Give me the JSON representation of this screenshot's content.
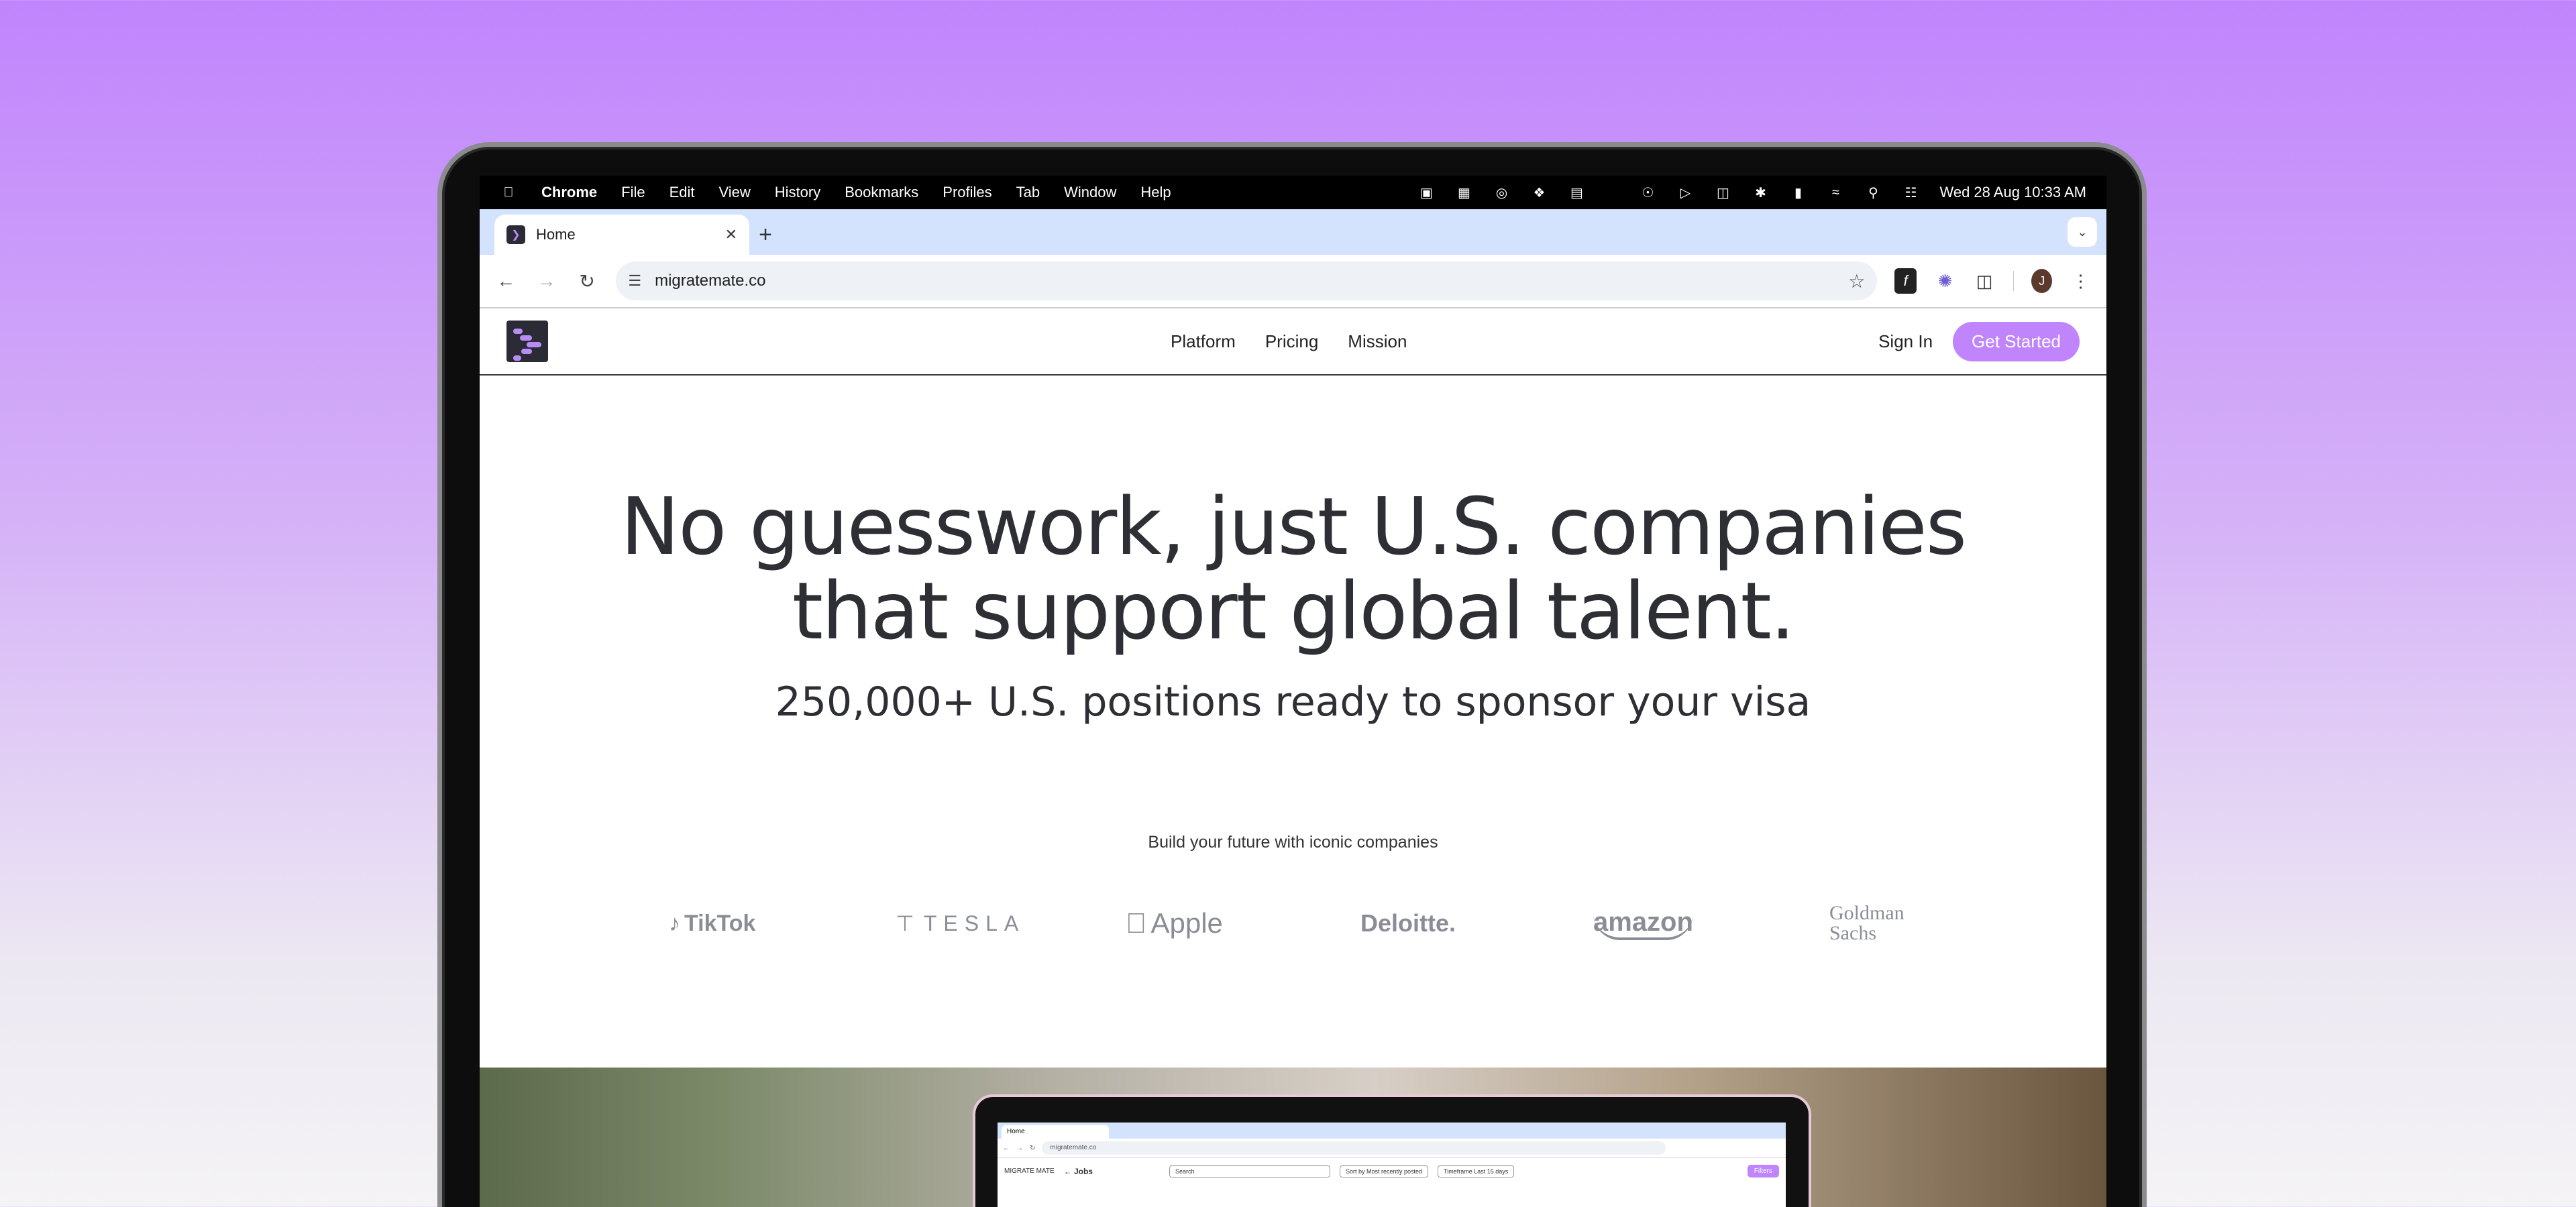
{
  "menubar": {
    "app": "Chrome",
    "items": [
      "File",
      "Edit",
      "View",
      "History",
      "Bookmarks",
      "Profiles",
      "Tab",
      "Window",
      "Help"
    ],
    "datetime": "Wed 28 Aug  10:33 AM"
  },
  "browser": {
    "tab_title": "Home",
    "url": "migratemate.co",
    "avatar_letter": "J"
  },
  "site": {
    "nav": [
      "Platform",
      "Pricing",
      "Mission"
    ],
    "sign_in": "Sign In",
    "cta": "Get Started",
    "hero_title_line1": "No guesswork, just U.S. companies",
    "hero_title_line2": "that support global talent.",
    "hero_subtitle": "250,000+ U.S. positions ready to sponsor your visa",
    "companies_label": "Build your future with iconic companies",
    "companies": [
      "TikTok",
      "TESLA",
      "Apple",
      "Deloitte.",
      "amazon",
      "Goldman",
      "Sachs"
    ]
  },
  "preview": {
    "tab_title": "Home",
    "url": "migratemate.co",
    "brand": "MIGRATE MATE",
    "page_title": "← Jobs",
    "search": "Search",
    "sort": "Sort by Most recently posted",
    "timeframe": "Timeframe Last 15 days",
    "filters": "Filters"
  },
  "colors": {
    "accent": "#c084fc",
    "background_top": "#c084fc",
    "text": "#2e2e35"
  }
}
